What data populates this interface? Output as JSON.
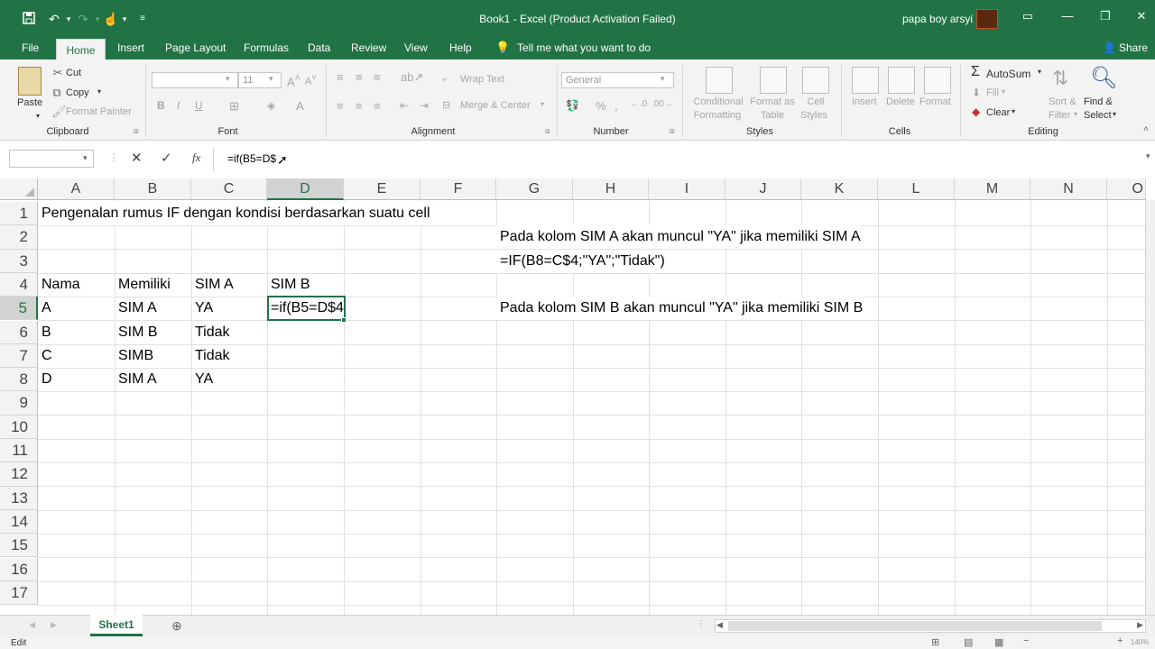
{
  "window": {
    "title": "Book1 - Excel (Product Activation Failed)",
    "user": "papa boy arsyi"
  },
  "tabs": {
    "file": "File",
    "home": "Home",
    "insert": "Insert",
    "page_layout": "Page Layout",
    "formulas": "Formulas",
    "data": "Data",
    "review": "Review",
    "view": "View",
    "help": "Help",
    "tell_me": "Tell me what you want to do",
    "share": "Share"
  },
  "ribbon": {
    "clipboard": {
      "paste": "Paste",
      "cut": "Cut",
      "copy": "Copy",
      "format_painter": "Format Painter",
      "label": "Clipboard"
    },
    "font": {
      "size": "11",
      "bold": "B",
      "italic": "I",
      "underline": "U",
      "label": "Font"
    },
    "alignment": {
      "wrap_text": "Wrap Text",
      "merge_center": "Merge & Center",
      "label": "Alignment"
    },
    "number": {
      "format": "General",
      "percent": "%",
      "comma": ",",
      "label": "Number"
    },
    "styles": {
      "conditional_1": "Conditional",
      "conditional_2": "Formatting",
      "format_as_1": "Format as",
      "format_as_2": "Table",
      "cell_1": "Cell",
      "cell_2": "Styles",
      "label": "Styles"
    },
    "cells": {
      "insert": "Insert",
      "delete": "Delete",
      "format": "Format",
      "label": "Cells"
    },
    "editing": {
      "autosum": "AutoSum",
      "fill": "Fill",
      "clear": "Clear",
      "sort_1": "Sort &",
      "sort_2": "Filter",
      "find_1": "Find &",
      "find_2": "Select",
      "label": "Editing"
    }
  },
  "formula_bar": {
    "name_box": "",
    "formula": "=if(B5=D$"
  },
  "columns": [
    "A",
    "B",
    "C",
    "D",
    "E",
    "F",
    "G",
    "H",
    "I",
    "J",
    "K",
    "L",
    "M",
    "N",
    "O"
  ],
  "rows": [
    "1",
    "2",
    "3",
    "4",
    "5",
    "6",
    "7",
    "8",
    "9",
    "10",
    "11",
    "12",
    "13",
    "14",
    "15",
    "16",
    "17"
  ],
  "cells": {
    "A1": "Pengenalan rumus IF dengan kondisi berdasarkan suatu cell",
    "G2": "Pada kolom SIM A akan muncul \"YA\" jika memiliki SIM A",
    "G3": "=IF(B8=C$4;\"YA\";\"Tidak\")",
    "A4": "Nama",
    "B4": "Memiliki",
    "C4": "SIM A",
    "D4": "SIM B",
    "A5": "A",
    "B5": "SIM A",
    "C5": "YA",
    "D5": "=if(B5=D$4",
    "G5": "Pada kolom SIM B akan muncul \"YA\" jika memiliki SIM B",
    "A6": "B",
    "B6": "SIM B",
    "C6": "Tidak",
    "A7": "C",
    "B7": "SIMB",
    "C7": "Tidak",
    "A8": "D",
    "B8": "SIM A",
    "C8": "YA"
  },
  "sheets": [
    "Sheet1"
  ],
  "status": {
    "mode": "Edit",
    "zoom": "140%"
  },
  "colors": {
    "accent": "#217346",
    "selected_header": "#d2d2d2"
  }
}
